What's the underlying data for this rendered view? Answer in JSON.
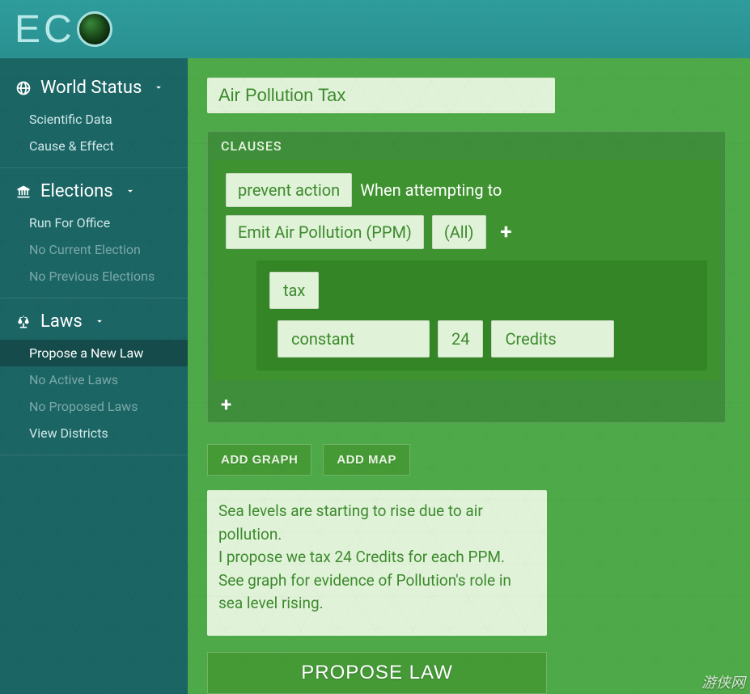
{
  "logo_letters": [
    "E",
    "C"
  ],
  "sidebar": {
    "sections": [
      {
        "title": "World Status",
        "icon": "globe-icon",
        "items": [
          {
            "label": "Scientific Data",
            "dim": false,
            "active": false
          },
          {
            "label": "Cause & Effect",
            "dim": false,
            "active": false
          }
        ]
      },
      {
        "title": "Elections",
        "icon": "building-icon",
        "items": [
          {
            "label": "Run For Office",
            "dim": false,
            "active": false
          },
          {
            "label": "No Current Election",
            "dim": true,
            "active": false
          },
          {
            "label": "No Previous Elections",
            "dim": true,
            "active": false
          }
        ]
      },
      {
        "title": "Laws",
        "icon": "scales-icon",
        "items": [
          {
            "label": "Propose a New Law",
            "dim": false,
            "active": true
          },
          {
            "label": "No Active Laws",
            "dim": true,
            "active": false
          },
          {
            "label": "No Proposed Laws",
            "dim": true,
            "active": false
          },
          {
            "label": "View Districts",
            "dim": false,
            "active": false
          }
        ]
      }
    ]
  },
  "main": {
    "law_title": "Air Pollution Tax",
    "clauses_header": "CLAUSES",
    "clause": {
      "action_token": "prevent action",
      "when_text": "When attempting to",
      "target_token": "Emit Air Pollution (PPM)",
      "filter_token": "(All)",
      "effect_token": "tax",
      "constant_token": "constant",
      "amount": "24",
      "currency_token": "Credits"
    },
    "add_graph_label": "ADD GRAPH",
    "add_map_label": "ADD MAP",
    "description": "Sea levels are starting to rise due to air pollution.\nI propose we tax 24 Credits for each PPM.\nSee graph for evidence of Pollution's role in sea level rising.",
    "propose_button": "PROPOSE LAW"
  },
  "watermark": "游侠网"
}
